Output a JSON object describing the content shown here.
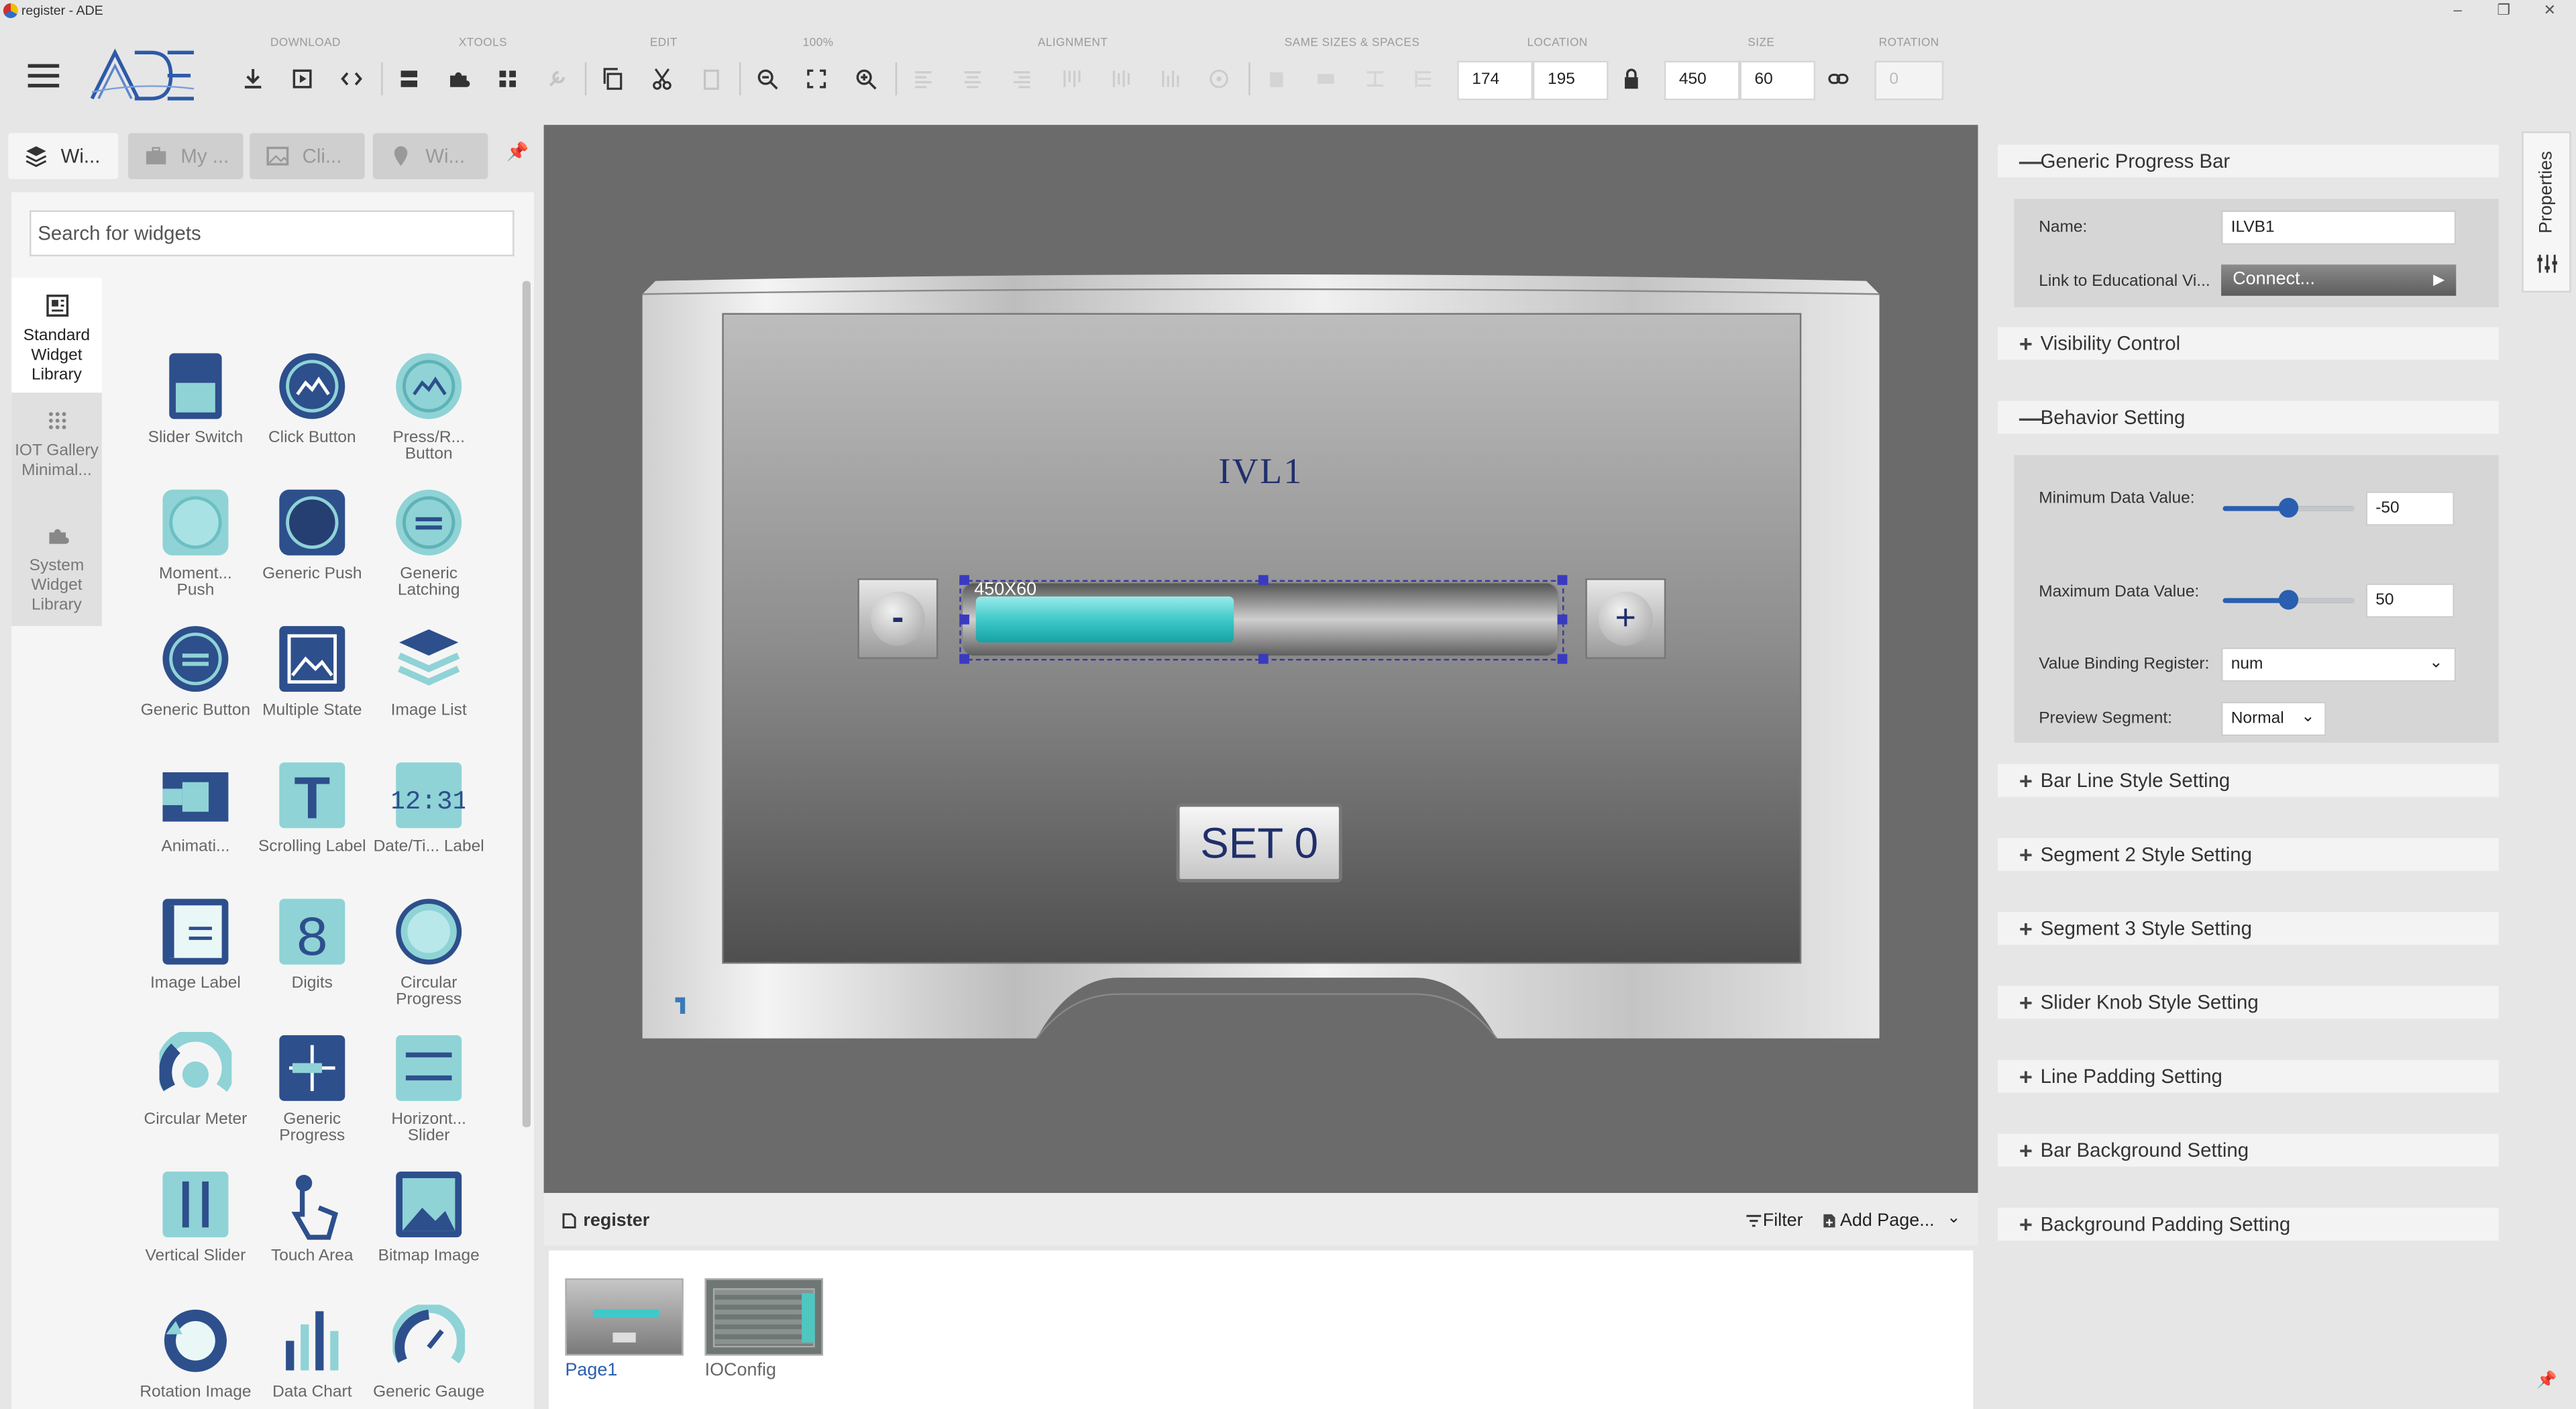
{
  "window": {
    "title": "register - ADE",
    "controls": [
      "–",
      "❐",
      "✕"
    ]
  },
  "toolbar": {
    "groups": [
      "DOWNLOAD",
      "XTOOLS",
      "EDIT",
      "100%",
      "ALIGNMENT",
      "SAME SIZES & SPACES",
      "LOCATION",
      "SIZE",
      "ROTATION"
    ],
    "location": {
      "x": "174",
      "y": "195"
    },
    "size": {
      "w": "450",
      "h": "60"
    },
    "rotation": "0"
  },
  "left_panel": {
    "tabs": [
      "Wi...",
      "My ...",
      "Cli...",
      "Wi..."
    ],
    "search_placeholder": "Search for widgets",
    "categories": [
      {
        "label": "Standard Widget Library"
      },
      {
        "label": "IOT Gallery Minimal..."
      },
      {
        "label": "System Widget Library"
      }
    ],
    "widgets": [
      "Slider Switch",
      "Click Button",
      "Press/R... Button",
      "Moment... Push",
      "Generic Push",
      "Generic Latching",
      "Generic Button",
      "Multiple State",
      "Image List",
      "Animati...",
      "Scrolling Label",
      "Date/Ti... Label",
      "Image Label",
      "Digits",
      "Circular Progress",
      "Circular Meter",
      "Generic Progress",
      "Horizont... Slider",
      "Vertical Slider",
      "Touch Area",
      "Bitmap Image",
      "Rotation Image",
      "Data Chart",
      "Generic Gauge"
    ]
  },
  "canvas": {
    "label": "IVL1",
    "minus": "-",
    "plus": "+",
    "size_tag": "450X60",
    "progress_value": 0.45,
    "set_button": "SET 0"
  },
  "pages": {
    "title": "register",
    "filter": "Filter",
    "add_page": "Add Page...",
    "items": [
      {
        "label": "Page1",
        "active": true
      },
      {
        "label": "IOConfig",
        "active": false
      }
    ]
  },
  "properties": {
    "tab_label": "Properties",
    "header": "Generic Progress Bar",
    "name_label": "Name:",
    "name_value": "ILVB1",
    "link_label": "Link to Educational Vi...",
    "connect": "Connect...",
    "visibility": "Visibility Control",
    "behavior": "Behavior Setting",
    "min_label": "Minimum Data Value:",
    "min_value": "-50",
    "min_slider": 0.5,
    "max_label": "Maximum Data Value:",
    "max_value": "50",
    "max_slider": 0.5,
    "binding_label": "Value Binding Register:",
    "binding_value": "num",
    "preview_label": "Preview Segment:",
    "preview_value": "Normal",
    "sections": [
      "Bar Line Style Setting",
      "Segment 2 Style Setting",
      "Segment 3 Style Setting",
      "Slider Knob Style Setting",
      "Line Padding Setting",
      "Bar Background Setting",
      "Background Padding Setting"
    ]
  },
  "colors": {
    "accent": "#2a5eb0",
    "bar_fill": "#3fc9c9",
    "canvas_bg": "#6b6b6b",
    "widget_teal": "#8fd3d6",
    "widget_navy": "#2d4f8c"
  }
}
